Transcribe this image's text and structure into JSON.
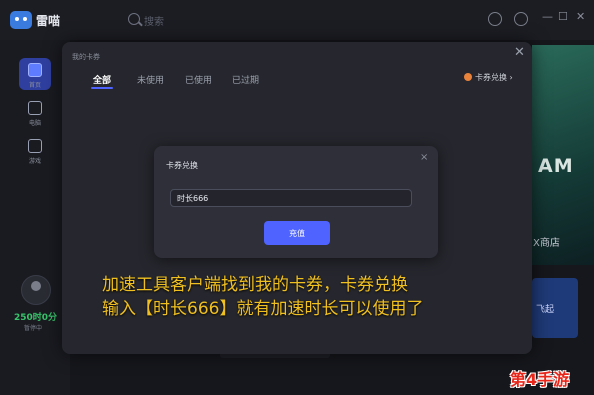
{
  "app": {
    "name": "雷喵"
  },
  "search": {
    "placeholder": "搜索"
  },
  "window_controls": {
    "minimize": "—",
    "maximize": "☐",
    "close": "✕"
  },
  "sidebar": {
    "items": [
      {
        "label": "首页",
        "icon": "home-icon",
        "active": true
      },
      {
        "label": "电脑",
        "icon": "monitor-icon",
        "active": false
      },
      {
        "label": "游戏",
        "icon": "gamepad-icon",
        "active": false
      }
    ],
    "user": {
      "points": "250时0分",
      "status": "暂停中"
    }
  },
  "background": {
    "game_title": "AM",
    "store_label": "X商店",
    "banner_text": "飞起"
  },
  "coupon_modal": {
    "title": "我的卡券",
    "close": "✕",
    "tabs": [
      {
        "label": "全部",
        "active": true
      },
      {
        "label": "未使用",
        "active": false
      },
      {
        "label": "已使用",
        "active": false
      },
      {
        "label": "已过期",
        "active": false
      }
    ],
    "redeem_link": "卡券兑换 ›"
  },
  "redeem_dialog": {
    "title": "卡券兑换",
    "close": "×",
    "input_value": "时长666",
    "button_label": "充值"
  },
  "caption": {
    "line1": "加速工具客户端找到我的卡券，卡券兑换",
    "line2": "输入【时长666】就有加速时长可以使用了"
  },
  "watermark": "第4手游",
  "colors": {
    "accent": "#4e63ff",
    "caption": "#f0c020",
    "points": "#37c46a",
    "watermark": "#e8261a"
  }
}
